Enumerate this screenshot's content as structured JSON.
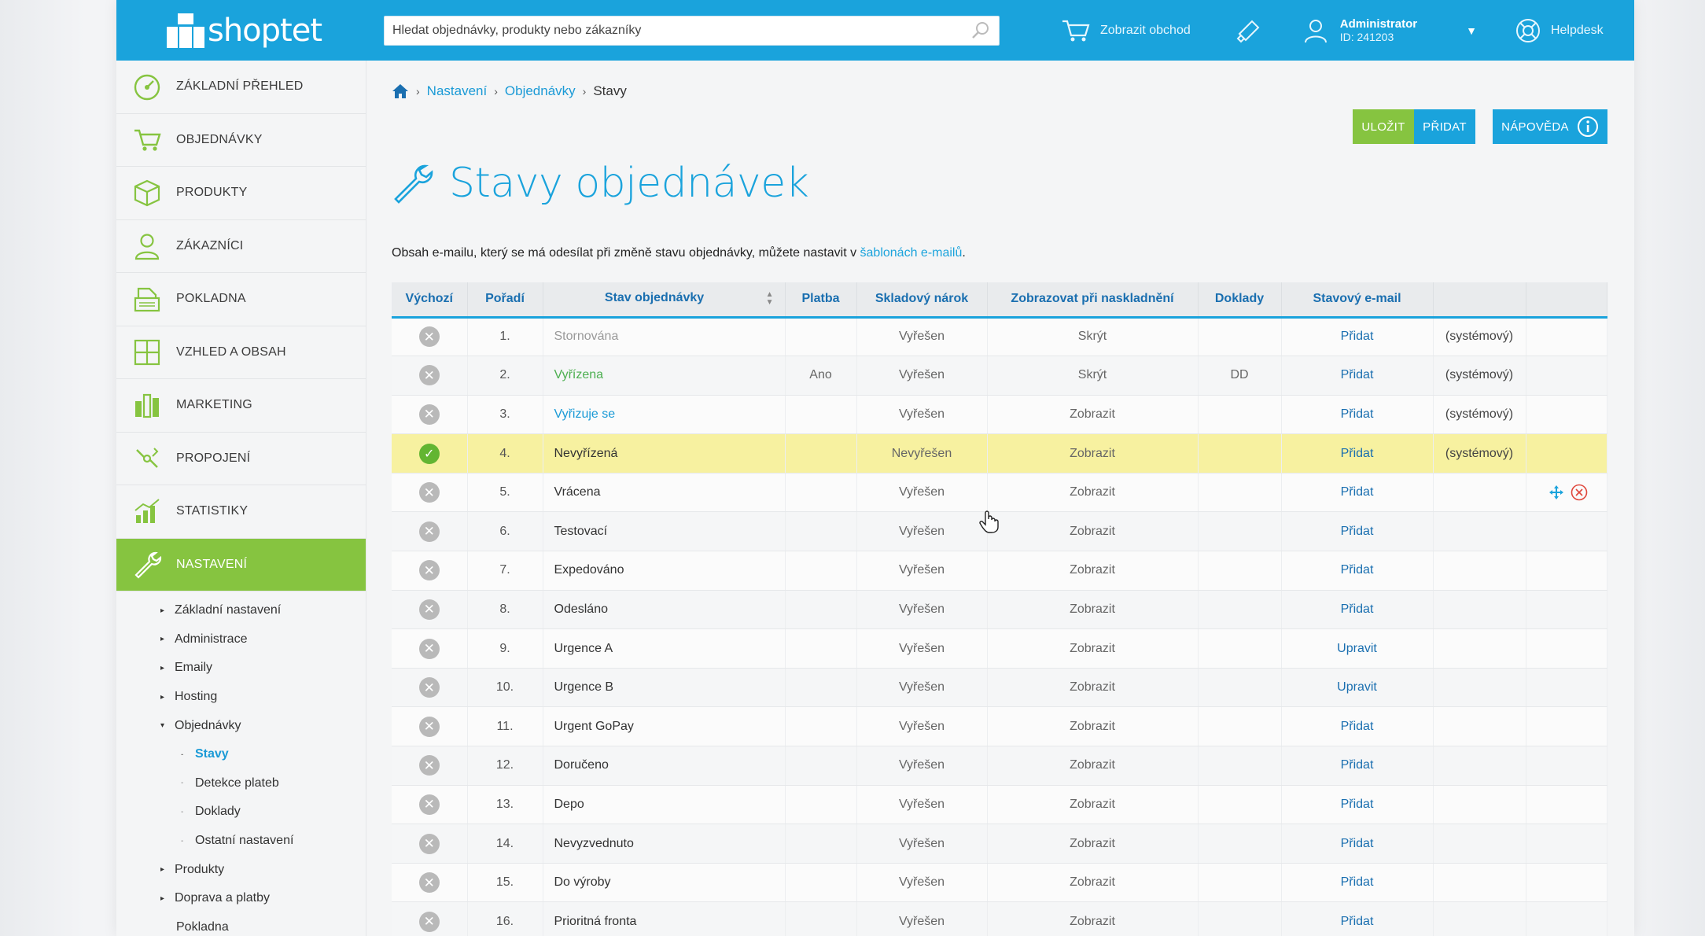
{
  "brand": {
    "name": "shoptet"
  },
  "topbar": {
    "search_placeholder": "Hledat objednávky, produkty nebo zákazníky",
    "store_link": "Zobrazit obchod",
    "user_name": "Administrator",
    "user_id": "ID: 241203",
    "helpdesk": "Helpdesk"
  },
  "sidebar": {
    "items": [
      {
        "label": "Základní přehled",
        "icon": "dashboard-icon"
      },
      {
        "label": "Objednávky",
        "icon": "cart-icon"
      },
      {
        "label": "Produkty",
        "icon": "box-icon"
      },
      {
        "label": "Zákazníci",
        "icon": "person-icon"
      },
      {
        "label": "Pokladna",
        "icon": "cash-register-icon"
      },
      {
        "label": "Vzhled a obsah",
        "icon": "layout-icon"
      },
      {
        "label": "Marketing",
        "icon": "marketing-icon"
      },
      {
        "label": "Propojení",
        "icon": "link-icon"
      },
      {
        "label": "Statistiky",
        "icon": "chart-icon"
      },
      {
        "label": "Nastavení",
        "icon": "wrench-icon"
      }
    ],
    "sub": [
      "Základní nastavení",
      "Administrace",
      "Emaily",
      "Hosting",
      "Objednávky",
      "Stavy",
      "Detekce plateb",
      "Doklady",
      "Ostatní nastavení",
      "Produkty",
      "Doprava a platby",
      "Pokladna"
    ]
  },
  "breadcrumb": {
    "item1": "Nastavení",
    "item2": "Objednávky",
    "current": "Stavy"
  },
  "actions": {
    "save": "Uložit",
    "add": "Přidat",
    "help": "Nápověda"
  },
  "page": {
    "title": "Stavy objednávek",
    "info_text": "Obsah e-mailu, který se má odesílat při změně stavu objednávky, můžete nastavit v ",
    "info_link": "šablonách e-mailů",
    "info_end": "."
  },
  "table": {
    "headers": [
      "Výchozí",
      "Pořadí",
      "Stav objednávky",
      "Platba",
      "Skladový nárok",
      "Zobrazovat při naskladnění",
      "Doklady",
      "Stavový e-mail"
    ],
    "rows": [
      {
        "default": false,
        "order": "1.",
        "name": "Stornována",
        "payment": "",
        "stock": "Vyřešen",
        "show": "Skrýt",
        "docs": "",
        "email": "Přidat",
        "system": "(systémový)"
      },
      {
        "default": false,
        "order": "2.",
        "name": "Vyřízena",
        "payment": "Ano",
        "stock": "Vyřešen",
        "show": "Skrýt",
        "docs": "DD",
        "email": "Přidat",
        "system": "(systémový)"
      },
      {
        "default": false,
        "order": "3.",
        "name": "Vyřizuje se",
        "payment": "",
        "stock": "Vyřešen",
        "show": "Zobrazit",
        "docs": "",
        "email": "Přidat",
        "system": "(systémový)"
      },
      {
        "default": true,
        "order": "4.",
        "name": "Nevyřízená",
        "payment": "",
        "stock": "Nevyřešen",
        "show": "Zobrazit",
        "docs": "",
        "email": "Přidat",
        "system": "(systémový)"
      },
      {
        "default": false,
        "order": "5.",
        "name": "Vrácena",
        "payment": "",
        "stock": "Vyřešen",
        "show": "Zobrazit",
        "docs": "",
        "email": "Přidat",
        "system": ""
      },
      {
        "default": false,
        "order": "6.",
        "name": "Testovací",
        "payment": "",
        "stock": "Vyřešen",
        "show": "Zobrazit",
        "docs": "",
        "email": "Přidat",
        "system": ""
      },
      {
        "default": false,
        "order": "7.",
        "name": "Expedováno",
        "payment": "",
        "stock": "Vyřešen",
        "show": "Zobrazit",
        "docs": "",
        "email": "Přidat",
        "system": ""
      },
      {
        "default": false,
        "order": "8.",
        "name": "Odesláno",
        "payment": "",
        "stock": "Vyřešen",
        "show": "Zobrazit",
        "docs": "",
        "email": "Přidat",
        "system": ""
      },
      {
        "default": false,
        "order": "9.",
        "name": "Urgence A",
        "payment": "",
        "stock": "Vyřešen",
        "show": "Zobrazit",
        "docs": "",
        "email": "Upravit",
        "system": ""
      },
      {
        "default": false,
        "order": "10.",
        "name": "Urgence B",
        "payment": "",
        "stock": "Vyřešen",
        "show": "Zobrazit",
        "docs": "",
        "email": "Upravit",
        "system": ""
      },
      {
        "default": false,
        "order": "11.",
        "name": "Urgent GoPay",
        "payment": "",
        "stock": "Vyřešen",
        "show": "Zobrazit",
        "docs": "",
        "email": "Přidat",
        "system": ""
      },
      {
        "default": false,
        "order": "12.",
        "name": "Doručeno",
        "payment": "",
        "stock": "Vyřešen",
        "show": "Zobrazit",
        "docs": "",
        "email": "Přidat",
        "system": ""
      },
      {
        "default": false,
        "order": "13.",
        "name": "Depo",
        "payment": "",
        "stock": "Vyřešen",
        "show": "Zobrazit",
        "docs": "",
        "email": "Přidat",
        "system": ""
      },
      {
        "default": false,
        "order": "14.",
        "name": "Nevyzvednuto",
        "payment": "",
        "stock": "Vyřešen",
        "show": "Zobrazit",
        "docs": "",
        "email": "Přidat",
        "system": ""
      },
      {
        "default": false,
        "order": "15.",
        "name": "Do výroby",
        "payment": "",
        "stock": "Vyřešen",
        "show": "Zobrazit",
        "docs": "",
        "email": "Přidat",
        "system": ""
      },
      {
        "default": false,
        "order": "16.",
        "name": "Prioritná fronta",
        "payment": "",
        "stock": "Vyřešen",
        "show": "Zobrazit",
        "docs": "",
        "email": "Přidat",
        "system": ""
      }
    ]
  },
  "colors": {
    "brand_blue": "#1aa3dc",
    "accent_green": "#86c440",
    "highlight_row": "#f7f1a0",
    "link_blue": "#1a6fb0"
  }
}
